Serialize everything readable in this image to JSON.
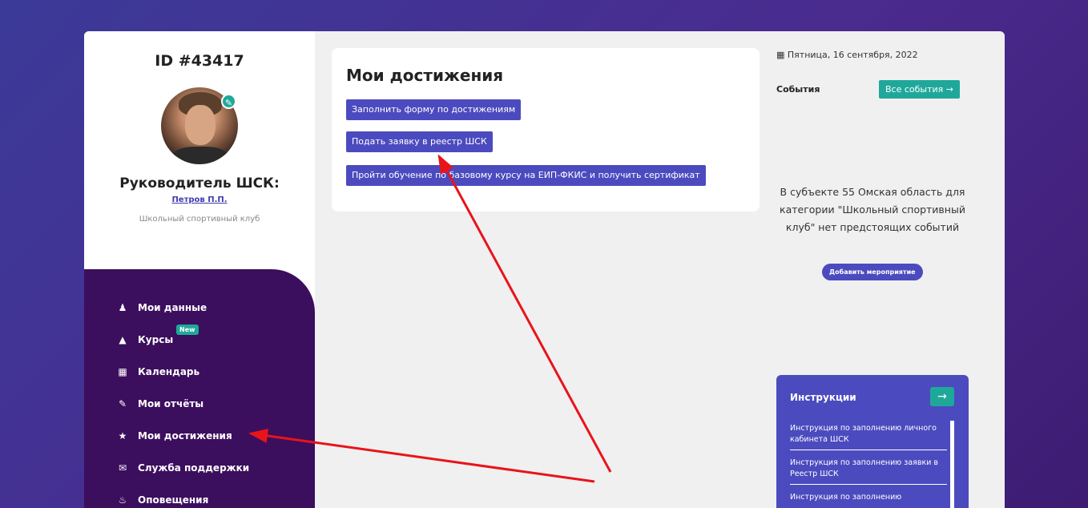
{
  "sidebar": {
    "user_id": "ID #43417",
    "role": "Руководитель ШСК:",
    "manager_name": "Петров П.П.",
    "organization": "Школьный спортивный клуб",
    "nav": [
      {
        "label": "Мои данные",
        "icon": "user-icon"
      },
      {
        "label": "Курсы",
        "icon": "graduation-cap-icon",
        "badge": "New"
      },
      {
        "label": "Календарь",
        "icon": "calendar-icon"
      },
      {
        "label": "Мои отчёты",
        "icon": "edit-icon"
      },
      {
        "label": "Мои достижения",
        "icon": "trophy-icon"
      },
      {
        "label": "Служба поддержки",
        "icon": "envelope-icon"
      },
      {
        "label": "Оповещения",
        "icon": "bell-icon"
      }
    ]
  },
  "main": {
    "title": "Мои достижения",
    "buttons": [
      "Заполнить форму по достижениям",
      "Подать заявку в реестр ШСК",
      "Пройти обучение по базовому курсу на ЕИП-ФКИС и получить сертификат"
    ]
  },
  "right": {
    "date": "Пятница, 16 сентября, 2022",
    "events_label": "События",
    "all_events": "Все события →",
    "no_events": "В субъекте 55 Омская область для категории \"Школьный спортивный клуб\" нет предстоящих событий",
    "add_event": "Добавить мероприятие",
    "instructions": {
      "title": "Инструкции",
      "items": [
        "Инструкция по заполнению личного кабинета ШСК",
        "Инструкция по заполнению заявки в Реестр ШСК",
        "Инструкция по заполнению"
      ]
    }
  },
  "colors": {
    "accent": "#4b4bbf",
    "teal": "#1fa89a",
    "nav_bg": "#3c0e5e",
    "annotation": "#e8141a"
  }
}
